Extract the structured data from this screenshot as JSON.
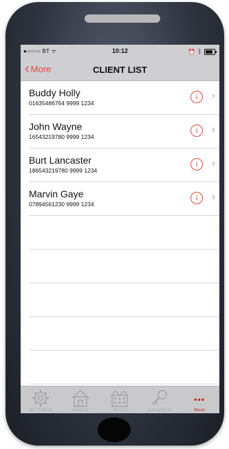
{
  "status_bar": {
    "carrier": "●○○○○ BT ᯤ",
    "time": "10:12"
  },
  "nav": {
    "back_label": "More",
    "title": "CLIENT LIST"
  },
  "clients": [
    {
      "name": "Buddy  Holly",
      "number": "01635486764 9999 1234"
    },
    {
      "name": "John  Wayne",
      "number": "16543219780 9999 1234"
    },
    {
      "name": "Burt Lancaster",
      "number": "186543219780 9999 1234"
    },
    {
      "name": "Marvin Gaye",
      "number": "07894561230 9999 1234"
    }
  ],
  "tabs": [
    {
      "label": "SETTINGS",
      "icon": "gear-icon"
    },
    {
      "label": "SINGLE",
      "icon": "house-icon"
    },
    {
      "label": "MULTI",
      "icon": "building-icon"
    },
    {
      "label": "CALLER ID",
      "icon": "key-icon"
    },
    {
      "label": "More",
      "icon": "more-dots-icon",
      "active": true
    }
  ],
  "colors": {
    "accent": "#e0483a",
    "tab_active": "#cc1c1c",
    "bar_bg": "#cfcfd1"
  }
}
